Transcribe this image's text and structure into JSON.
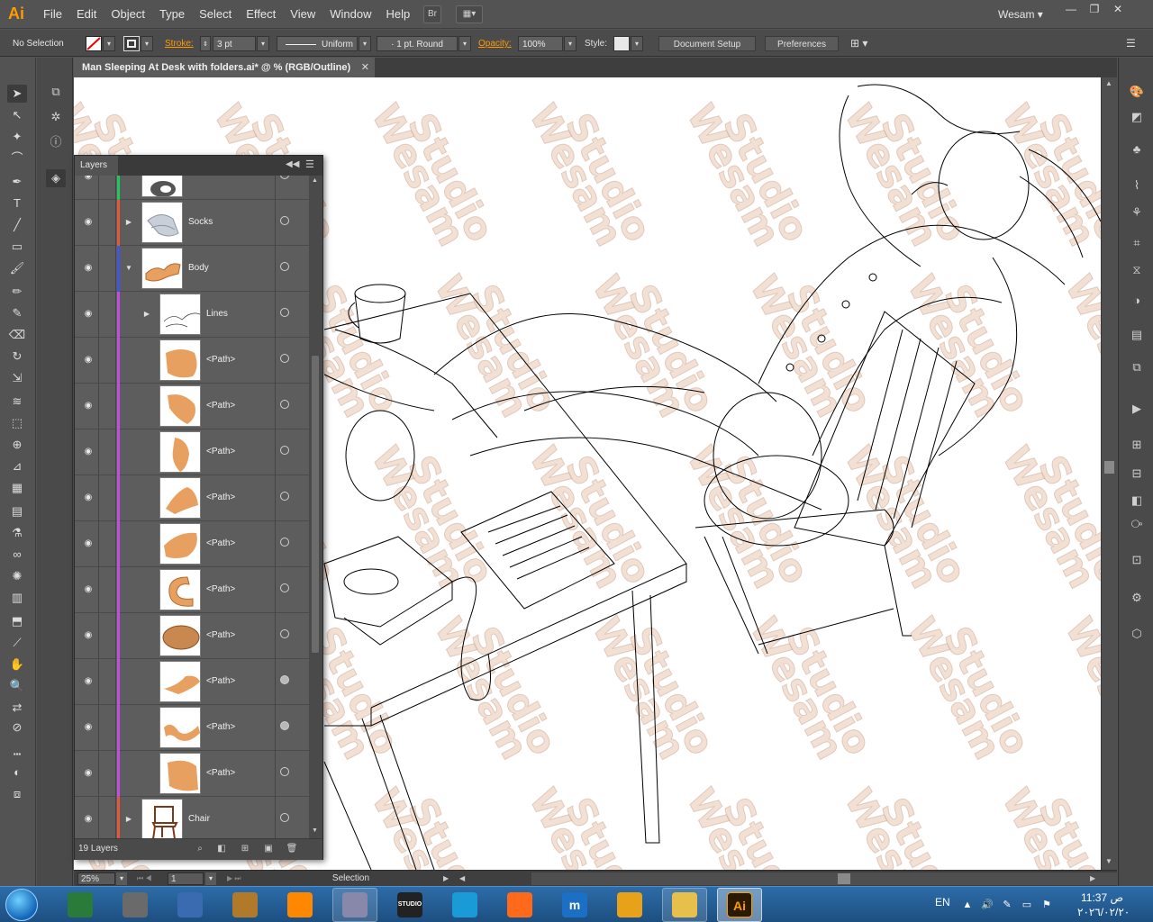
{
  "app": {
    "logo": "Ai",
    "menu": [
      "File",
      "Edit",
      "Object",
      "Type",
      "Select",
      "Effect",
      "View",
      "Window",
      "Help"
    ],
    "bridge_button": "Br",
    "user": "Wesam",
    "window_controls": {
      "minimize": "—",
      "restore": "❐",
      "close": "✕"
    }
  },
  "controlbar": {
    "selection_status": "No Selection",
    "stroke_label": "Stroke:",
    "stroke_weight": "3 pt",
    "stroke_profile": "Uniform",
    "brush": "1 pt. Round",
    "opacity_label": "Opacity:",
    "opacity_value": "100%",
    "style_label": "Style:",
    "document_setup": "Document Setup",
    "preferences": "Preferences"
  },
  "document": {
    "tab_title": "Man Sleeping At Desk with folders.ai* @ % (RGB/Outline)",
    "close_glyph": "✕",
    "watermark": "Wesam Studio"
  },
  "layers_panel": {
    "title": "Layers",
    "count_label": "19 Layers",
    "rows": [
      {
        "name": "",
        "color": "#22c55e",
        "indent": 0,
        "expander": "",
        "thumb": "feet",
        "target_filled": false
      },
      {
        "name": "Socks",
        "color": "#e4573a",
        "indent": 0,
        "expander": "▶",
        "thumb": "socks",
        "target_filled": false
      },
      {
        "name": "Body",
        "color": "#4455dd",
        "indent": 0,
        "expander": "▼",
        "thumb": "body",
        "target_filled": false
      },
      {
        "name": "Lines",
        "color": "#c04ee0",
        "indent": 1,
        "expander": "▶",
        "thumb": "lines",
        "target_filled": false
      },
      {
        "name": "<Path>",
        "color": "#c04ee0",
        "indent": 1,
        "expander": "",
        "thumb": "path1",
        "target_filled": false
      },
      {
        "name": "<Path>",
        "color": "#c04ee0",
        "indent": 1,
        "expander": "",
        "thumb": "path2",
        "target_filled": false
      },
      {
        "name": "<Path>",
        "color": "#c04ee0",
        "indent": 1,
        "expander": "",
        "thumb": "path3",
        "target_filled": false
      },
      {
        "name": "<Path>",
        "color": "#c04ee0",
        "indent": 1,
        "expander": "",
        "thumb": "path4",
        "target_filled": false
      },
      {
        "name": "<Path>",
        "color": "#c04ee0",
        "indent": 1,
        "expander": "",
        "thumb": "path5",
        "target_filled": false
      },
      {
        "name": "<Path>",
        "color": "#c04ee0",
        "indent": 1,
        "expander": "",
        "thumb": "path6",
        "target_filled": false
      },
      {
        "name": "<Path>",
        "color": "#c04ee0",
        "indent": 1,
        "expander": "",
        "thumb": "path7",
        "target_filled": false
      },
      {
        "name": "<Path>",
        "color": "#c04ee0",
        "indent": 1,
        "expander": "",
        "thumb": "path8",
        "target_filled": true
      },
      {
        "name": "<Path>",
        "color": "#c04ee0",
        "indent": 1,
        "expander": "",
        "thumb": "path9",
        "target_filled": true
      },
      {
        "name": "<Path>",
        "color": "#c04ee0",
        "indent": 1,
        "expander": "",
        "thumb": "path10",
        "target_filled": false
      },
      {
        "name": "Chair",
        "color": "#e4573a",
        "indent": 0,
        "expander": "▶",
        "thumb": "chair",
        "target_filled": false
      }
    ]
  },
  "statusbar": {
    "zoom": "25%",
    "artboard": "1",
    "tool": "Selection"
  },
  "taskbar": {
    "apps": [
      {
        "name": "photo-viewer",
        "label": "",
        "color": "#2a7a3a",
        "state": "pinned"
      },
      {
        "name": "scanner",
        "label": "",
        "color": "#6a6a6a",
        "state": "pinned"
      },
      {
        "name": "pen-tablet",
        "label": "",
        "color": "#3a6ab0",
        "state": "pinned"
      },
      {
        "name": "eye-app",
        "label": "",
        "color": "#b07a2a",
        "state": "pinned"
      },
      {
        "name": "vlc",
        "label": "",
        "color": "#ff8800",
        "state": "pinned"
      },
      {
        "name": "tools",
        "label": "",
        "color": "#8888aa",
        "state": "open"
      },
      {
        "name": "studio",
        "label": "STUDIO",
        "color": "#222222",
        "state": "pinned"
      },
      {
        "name": "edge",
        "label": "",
        "color": "#1a9ad6",
        "state": "pinned"
      },
      {
        "name": "firefox",
        "label": "",
        "color": "#ff6a1a",
        "state": "pinned"
      },
      {
        "name": "maxon",
        "label": "m",
        "color": "#1b6fc4",
        "state": "pinned"
      },
      {
        "name": "chrome",
        "label": "",
        "color": "#e8a21a",
        "state": "pinned"
      },
      {
        "name": "explorer",
        "label": "",
        "color": "#e6c04a",
        "state": "open"
      },
      {
        "name": "illustrator",
        "label": "Ai",
        "color": "#2b1a00",
        "state": "active"
      }
    ],
    "language": "EN",
    "time": "11:37 ص",
    "date": "٢٠٢٦/٠٢/٢٠"
  }
}
